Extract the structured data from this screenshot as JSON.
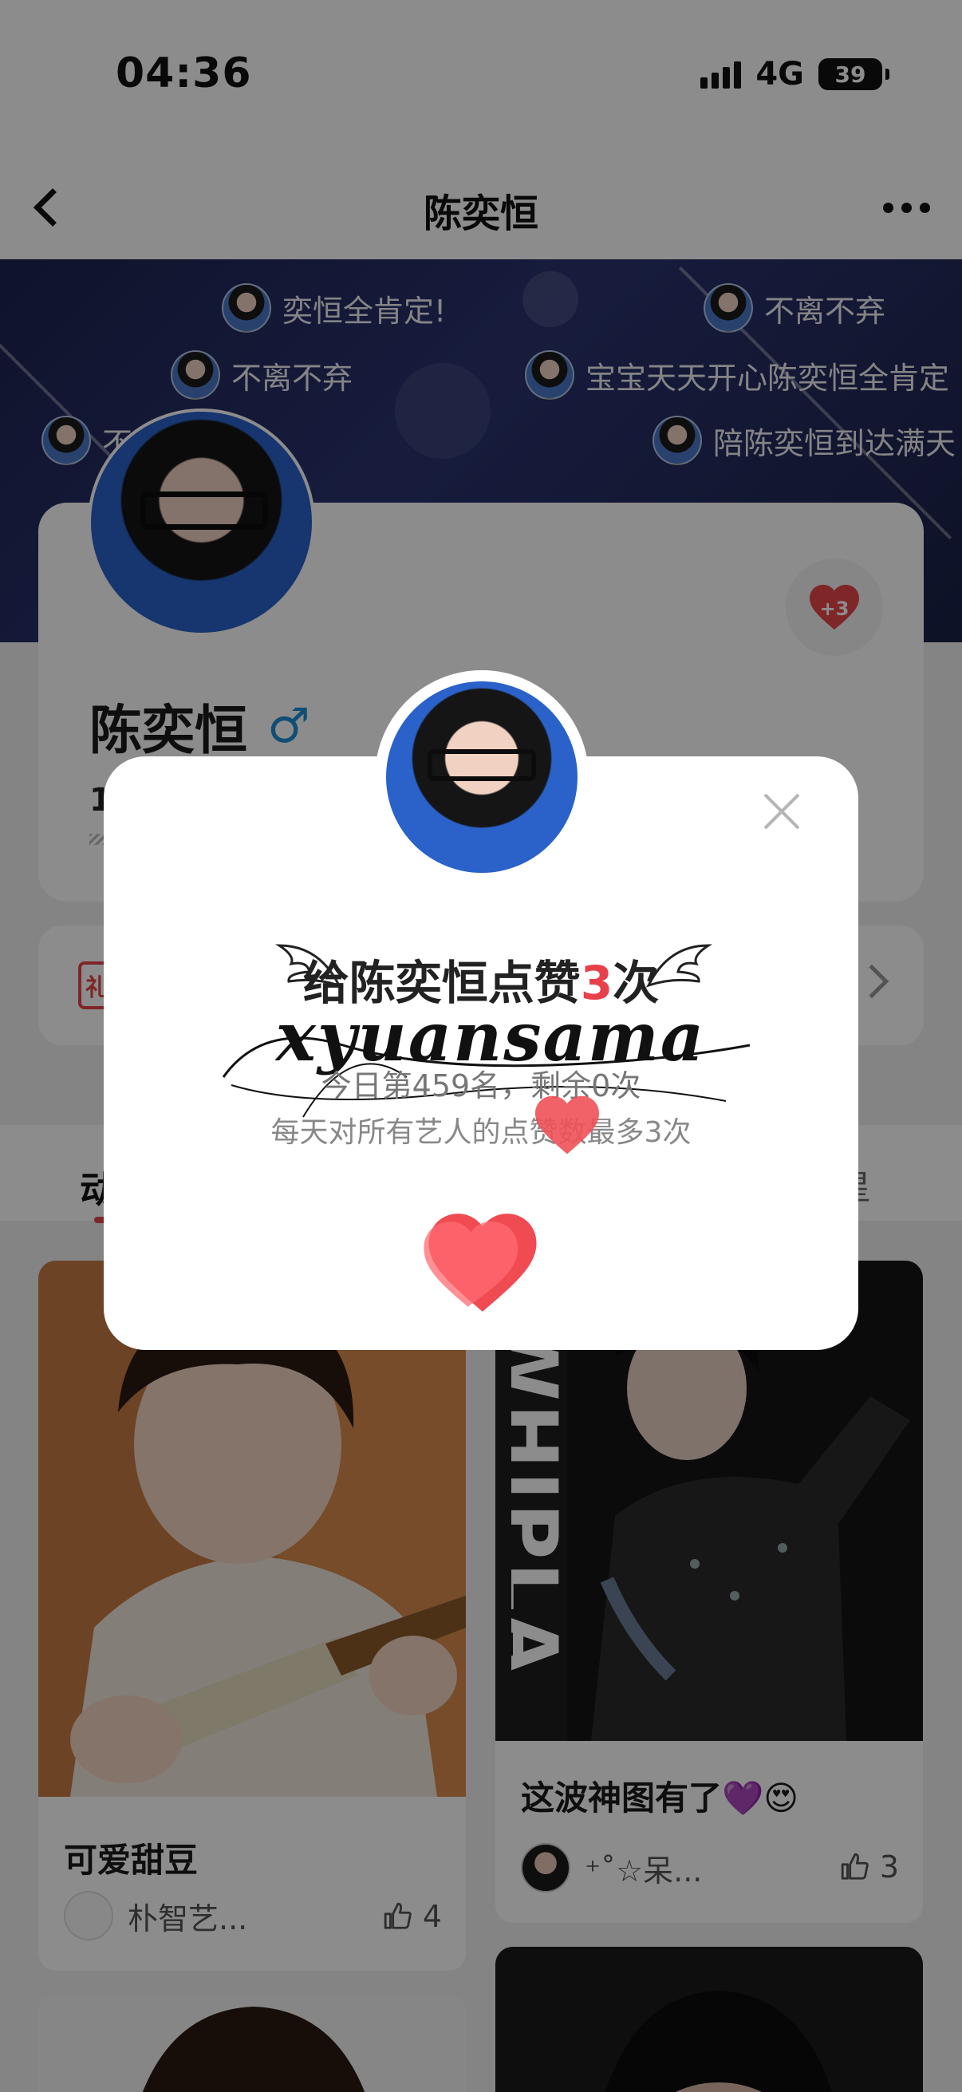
{
  "status_bar": {
    "time": "04:36",
    "network": "4G",
    "battery": "39"
  },
  "nav": {
    "title": "陈奕恒"
  },
  "danmaku": [
    {
      "text": "奕恒全肯定!"
    },
    {
      "text": "不离不弃"
    },
    {
      "text": "不离不弃"
    },
    {
      "text": "宝宝天天开心陈奕恒全肯定"
    },
    {
      "text": "不"
    },
    {
      "text": "陪陈奕恒到达满天"
    }
  ],
  "profile": {
    "name": "陈奕恒",
    "gender_symbol": "♂",
    "heart_bonus": "+3",
    "stat_partial": "1"
  },
  "checkin": {
    "badge": "礼"
  },
  "tabs": {
    "first": "动",
    "last": "星"
  },
  "feed": [
    {
      "title": "可爱甜豆",
      "author": "朴智艺...",
      "likes": "4"
    },
    {
      "title": "这波神图有了💜😍",
      "author": "⁺˚☆呆...",
      "likes": "3"
    }
  ],
  "image_text": {
    "whiplash": "WHIPLA"
  },
  "modal": {
    "title_prefix": "给陈奕恒点赞",
    "title_count": "3",
    "title_suffix": "次",
    "watermark": "xyuansama",
    "line1": "今日第459名，剩余0次",
    "line2": "每天对所有艺人的点赞数最多3次"
  },
  "colors": {
    "accent": "#e8404a",
    "banner": "#2b3470",
    "overlay": "rgba(0,0,0,0.45)"
  },
  "icons": [
    "back-arrow-icon",
    "more-icon",
    "heart-icon",
    "male-icon",
    "close-icon",
    "thumb-up-icon",
    "chevron-right-icon"
  ]
}
